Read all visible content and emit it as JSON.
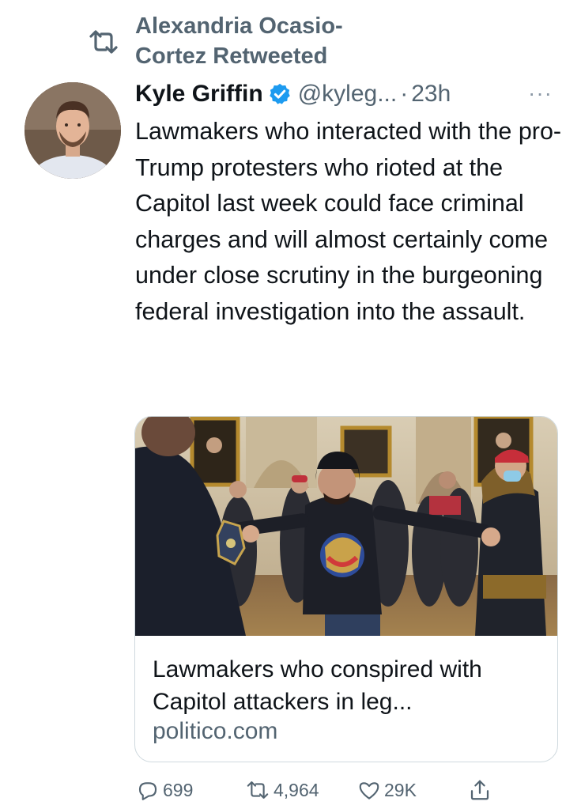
{
  "retweet": {
    "label": "Alexandria Ocasio-Cortez Retweeted",
    "icon": "retweet-icon"
  },
  "author": {
    "name": "Kyle Griffin",
    "verified_icon": "verified-badge-icon",
    "handle": "@kyleg...",
    "separator": "·",
    "time": "23h",
    "more_icon": "more-horizontal-icon",
    "more_label": "···"
  },
  "tweet": {
    "text": "Lawmakers who interacted with the pro-Trump protesters who rioted at the Capitol last week could face criminal charges and will almost certainly come under close scrutiny in the burgeoning federal investigation into the assault."
  },
  "card": {
    "image_icon": "news-photo",
    "title": "Lawmakers who conspired with Capitol attackers in leg...",
    "domain": "politico.com"
  },
  "actions": {
    "replies": "699",
    "retweets": "4,964",
    "likes": "29K",
    "reply_icon": "reply-icon",
    "retweet_icon": "retweet-icon",
    "like_icon": "heart-icon",
    "share_icon": "share-icon"
  },
  "colors": {
    "text": "#0f1419",
    "secondary": "#536471",
    "verified": "#1d9bf0",
    "border": "#cfd9de"
  }
}
